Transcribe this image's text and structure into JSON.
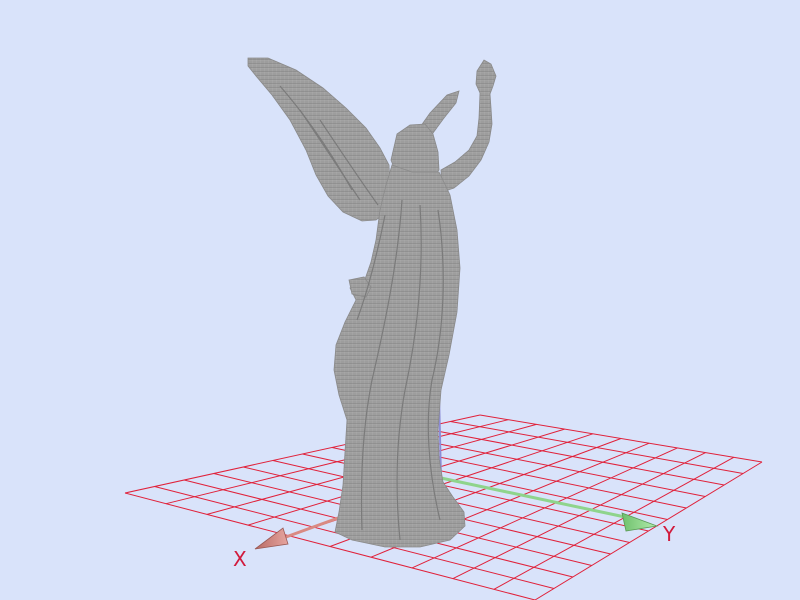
{
  "scene": {
    "background_color": "#d9e3fa",
    "model": {
      "name": "winged-angel-statue-voxel",
      "color": "#9d9d9d"
    },
    "grid": {
      "visible": true,
      "color": "#e0213a"
    },
    "axes": {
      "x": {
        "label": "X",
        "color": "#d98a83"
      },
      "y": {
        "label": "Y",
        "color": "#8fd48c"
      },
      "z": {
        "label": "",
        "color": "#8c8cd6"
      }
    }
  }
}
